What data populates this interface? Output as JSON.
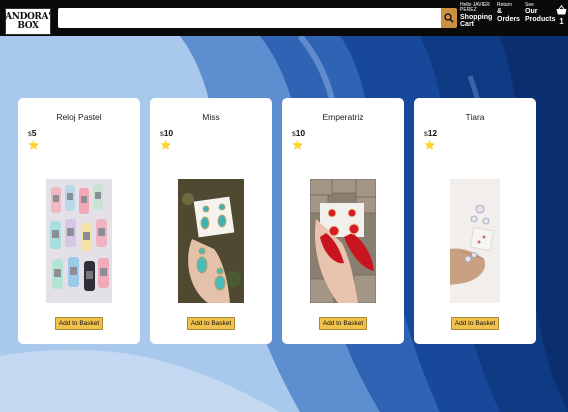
{
  "header": {
    "logo_line1": "PANDORA'S",
    "logo_line2": "BOX",
    "search": {
      "value": "",
      "placeholder": ""
    },
    "user_greeting": "Hello JAVIER PEREZ",
    "user_link": "Shopping Cart",
    "returns_line1": "Return",
    "returns_line2": "& Orders",
    "products_line1": "See",
    "products_line2": "Our Products",
    "basket_count": "1"
  },
  "products": [
    {
      "title": "Reloj Pastel",
      "currency": "$",
      "price": "5",
      "rating": "⭐",
      "button": "Add to Basket",
      "image": "pastel-watches"
    },
    {
      "title": "Miss",
      "currency": "$",
      "price": "10",
      "rating": "⭐",
      "button": "Add to Basket",
      "image": "turquoise-earrings"
    },
    {
      "title": "Emperatriz",
      "currency": "$",
      "price": "10",
      "rating": "⭐",
      "button": "Add to Basket",
      "image": "red-tassel-earrings"
    },
    {
      "title": "Tiara",
      "currency": "$",
      "price": "12",
      "rating": "⭐",
      "button": "Add to Basket",
      "image": "crystal-rings"
    }
  ],
  "colors": {
    "header_bg": "#0a0a0a",
    "search_button": "#cd9042",
    "add_button": "#f0c14b",
    "background_light": "#9ec3e8",
    "background_dark": "#1a4a9c"
  }
}
